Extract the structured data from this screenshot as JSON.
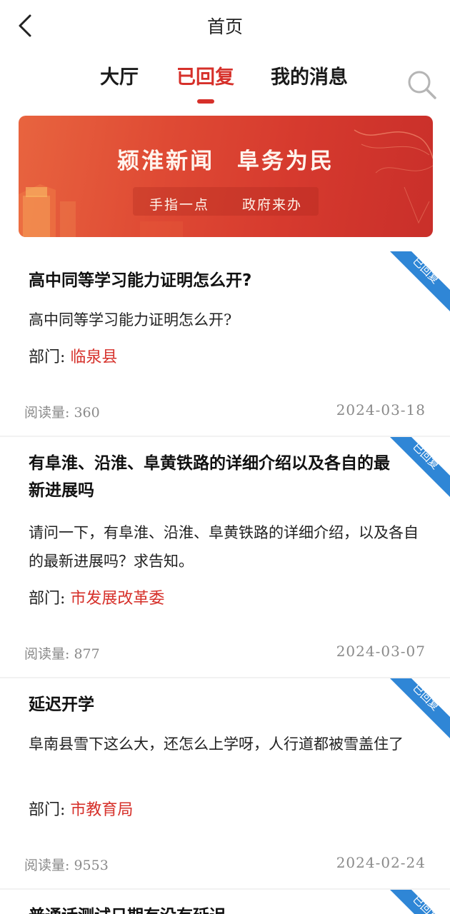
{
  "header": {
    "title": "首页",
    "back_icon": "chevron-left-icon"
  },
  "tabs": [
    {
      "label": "大厅",
      "active": false
    },
    {
      "label": "已回复",
      "active": true
    },
    {
      "label": "我的消息",
      "active": false
    }
  ],
  "search": {
    "icon": "search-icon"
  },
  "banner": {
    "slogan": "颍淮新闻  阜务为民",
    "sub1": "手指一点",
    "sub2": "政府来办"
  },
  "colors": {
    "accent": "#d6302a",
    "ribbon": "#2f86d6",
    "muted": "#8a8a8a"
  },
  "posts": [
    {
      "title": "高中同等学习能力证明怎么开?",
      "body": "高中同等学习能力证明怎么开?",
      "dept_label": "部门:",
      "dept": "临泉县",
      "views": "阅读量: 360",
      "date": "2024-03-18",
      "badge": "已回复"
    },
    {
      "title": "有阜淮、沿淮、阜黄铁路的详细介绍以及各自的最新进展吗",
      "body": "请问一下，有阜淮、沿淮、阜黄铁路的详细介绍，以及各自的最新进展吗？求告知。",
      "dept_label": "部门:",
      "dept": "市发展改革委",
      "views": "阅读量: 877",
      "date": "2024-03-07",
      "badge": "已回复"
    },
    {
      "title": "延迟开学",
      "body": "阜南县雪下这么大，还怎么上学呀，人行道都被雪盖住了",
      "dept_label": "部门:",
      "dept": "市教育局",
      "views": "阅读量: 9553",
      "date": "2024-02-24",
      "badge": "已回复"
    },
    {
      "title": "普通话测试日期有没有延迟",
      "badge": "已回复"
    }
  ]
}
